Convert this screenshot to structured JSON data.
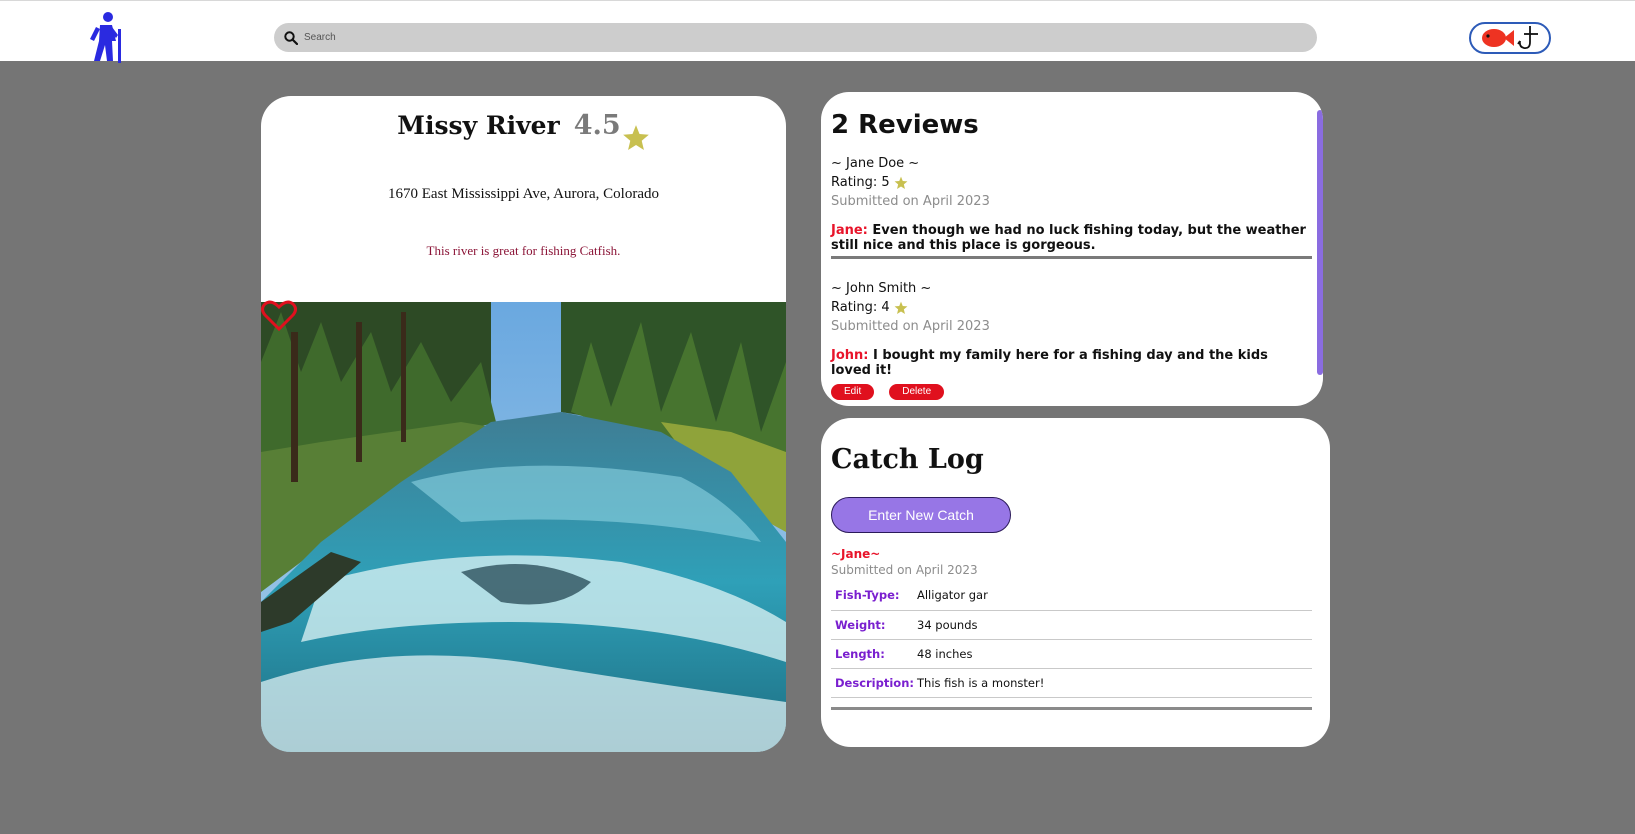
{
  "header": {
    "search_placeholder": "Search"
  },
  "river": {
    "name": "Missy River",
    "rating": "4.5",
    "address": "1670 East Mississippi Ave, Aurora, Colorado",
    "description": "This river is great for fishing Catfish."
  },
  "reviews": {
    "title": "2 Reviews",
    "items": [
      {
        "author": "~ Jane Doe ~",
        "rating_label": "Rating: 5",
        "date": "Submitted on April 2023",
        "who": "Jane:",
        "text": "Even though we had no luck fishing today, but the weather still nice and this place is gorgeous."
      },
      {
        "author": "~ John Smith ~",
        "rating_label": "Rating: 4",
        "date": "Submitted on April 2023",
        "who": "John:",
        "text": "I bought my family here for a fishing day and the kids loved it!",
        "edit_label": "Edit",
        "delete_label": "Delete"
      }
    ]
  },
  "catch_log": {
    "title": "Catch Log",
    "button_label": "Enter New Catch",
    "entry": {
      "user": "~Jane~",
      "date": "Submitted on April 2023",
      "fields": [
        {
          "label": "Fish-Type:",
          "value": "Alligator gar"
        },
        {
          "label": "Weight:",
          "value": "34 pounds"
        },
        {
          "label": "Length:",
          "value": "48 inches"
        },
        {
          "label": "Description:",
          "value": "This fish is a monster!"
        }
      ]
    }
  },
  "colors": {
    "page_bg": "#757575",
    "accent_purple": "#9776e6",
    "danger_red": "#e0101e",
    "star_olive": "#c8c050",
    "logo_blue": "#2a2ae0"
  }
}
